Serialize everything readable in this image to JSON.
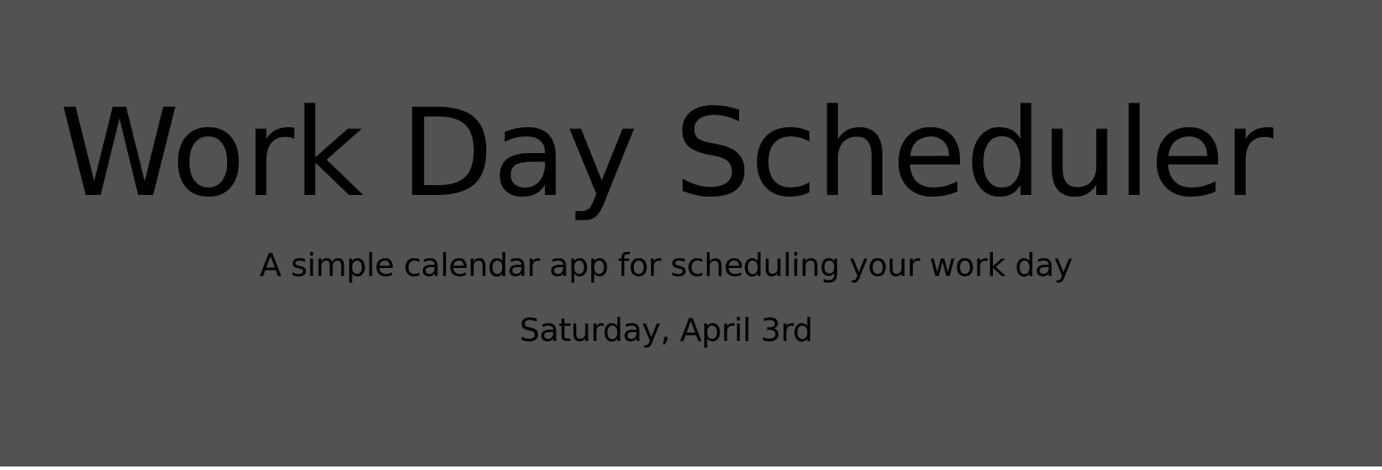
{
  "header": {
    "title": "Work Day Scheduler",
    "subtitle": "A simple calendar app for scheduling your work day",
    "current_day": "Saturday, April 3rd"
  },
  "colors": {
    "background": "#525252",
    "text": "#000000"
  }
}
